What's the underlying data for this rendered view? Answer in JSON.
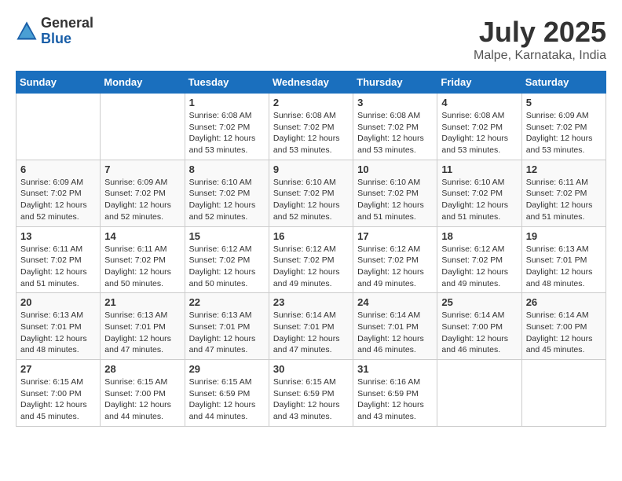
{
  "header": {
    "logo_general": "General",
    "logo_blue": "Blue",
    "month": "July 2025",
    "location": "Malpe, Karnataka, India"
  },
  "weekdays": [
    "Sunday",
    "Monday",
    "Tuesday",
    "Wednesday",
    "Thursday",
    "Friday",
    "Saturday"
  ],
  "weeks": [
    [
      {
        "day": "",
        "detail": ""
      },
      {
        "day": "",
        "detail": ""
      },
      {
        "day": "1",
        "detail": "Sunrise: 6:08 AM\nSunset: 7:02 PM\nDaylight: 12 hours and 53 minutes."
      },
      {
        "day": "2",
        "detail": "Sunrise: 6:08 AM\nSunset: 7:02 PM\nDaylight: 12 hours and 53 minutes."
      },
      {
        "day": "3",
        "detail": "Sunrise: 6:08 AM\nSunset: 7:02 PM\nDaylight: 12 hours and 53 minutes."
      },
      {
        "day": "4",
        "detail": "Sunrise: 6:08 AM\nSunset: 7:02 PM\nDaylight: 12 hours and 53 minutes."
      },
      {
        "day": "5",
        "detail": "Sunrise: 6:09 AM\nSunset: 7:02 PM\nDaylight: 12 hours and 53 minutes."
      }
    ],
    [
      {
        "day": "6",
        "detail": "Sunrise: 6:09 AM\nSunset: 7:02 PM\nDaylight: 12 hours and 52 minutes."
      },
      {
        "day": "7",
        "detail": "Sunrise: 6:09 AM\nSunset: 7:02 PM\nDaylight: 12 hours and 52 minutes."
      },
      {
        "day": "8",
        "detail": "Sunrise: 6:10 AM\nSunset: 7:02 PM\nDaylight: 12 hours and 52 minutes."
      },
      {
        "day": "9",
        "detail": "Sunrise: 6:10 AM\nSunset: 7:02 PM\nDaylight: 12 hours and 52 minutes."
      },
      {
        "day": "10",
        "detail": "Sunrise: 6:10 AM\nSunset: 7:02 PM\nDaylight: 12 hours and 51 minutes."
      },
      {
        "day": "11",
        "detail": "Sunrise: 6:10 AM\nSunset: 7:02 PM\nDaylight: 12 hours and 51 minutes."
      },
      {
        "day": "12",
        "detail": "Sunrise: 6:11 AM\nSunset: 7:02 PM\nDaylight: 12 hours and 51 minutes."
      }
    ],
    [
      {
        "day": "13",
        "detail": "Sunrise: 6:11 AM\nSunset: 7:02 PM\nDaylight: 12 hours and 51 minutes."
      },
      {
        "day": "14",
        "detail": "Sunrise: 6:11 AM\nSunset: 7:02 PM\nDaylight: 12 hours and 50 minutes."
      },
      {
        "day": "15",
        "detail": "Sunrise: 6:12 AM\nSunset: 7:02 PM\nDaylight: 12 hours and 50 minutes."
      },
      {
        "day": "16",
        "detail": "Sunrise: 6:12 AM\nSunset: 7:02 PM\nDaylight: 12 hours and 49 minutes."
      },
      {
        "day": "17",
        "detail": "Sunrise: 6:12 AM\nSunset: 7:02 PM\nDaylight: 12 hours and 49 minutes."
      },
      {
        "day": "18",
        "detail": "Sunrise: 6:12 AM\nSunset: 7:02 PM\nDaylight: 12 hours and 49 minutes."
      },
      {
        "day": "19",
        "detail": "Sunrise: 6:13 AM\nSunset: 7:01 PM\nDaylight: 12 hours and 48 minutes."
      }
    ],
    [
      {
        "day": "20",
        "detail": "Sunrise: 6:13 AM\nSunset: 7:01 PM\nDaylight: 12 hours and 48 minutes."
      },
      {
        "day": "21",
        "detail": "Sunrise: 6:13 AM\nSunset: 7:01 PM\nDaylight: 12 hours and 47 minutes."
      },
      {
        "day": "22",
        "detail": "Sunrise: 6:13 AM\nSunset: 7:01 PM\nDaylight: 12 hours and 47 minutes."
      },
      {
        "day": "23",
        "detail": "Sunrise: 6:14 AM\nSunset: 7:01 PM\nDaylight: 12 hours and 47 minutes."
      },
      {
        "day": "24",
        "detail": "Sunrise: 6:14 AM\nSunset: 7:01 PM\nDaylight: 12 hours and 46 minutes."
      },
      {
        "day": "25",
        "detail": "Sunrise: 6:14 AM\nSunset: 7:00 PM\nDaylight: 12 hours and 46 minutes."
      },
      {
        "day": "26",
        "detail": "Sunrise: 6:14 AM\nSunset: 7:00 PM\nDaylight: 12 hours and 45 minutes."
      }
    ],
    [
      {
        "day": "27",
        "detail": "Sunrise: 6:15 AM\nSunset: 7:00 PM\nDaylight: 12 hours and 45 minutes."
      },
      {
        "day": "28",
        "detail": "Sunrise: 6:15 AM\nSunset: 7:00 PM\nDaylight: 12 hours and 44 minutes."
      },
      {
        "day": "29",
        "detail": "Sunrise: 6:15 AM\nSunset: 6:59 PM\nDaylight: 12 hours and 44 minutes."
      },
      {
        "day": "30",
        "detail": "Sunrise: 6:15 AM\nSunset: 6:59 PM\nDaylight: 12 hours and 43 minutes."
      },
      {
        "day": "31",
        "detail": "Sunrise: 6:16 AM\nSunset: 6:59 PM\nDaylight: 12 hours and 43 minutes."
      },
      {
        "day": "",
        "detail": ""
      },
      {
        "day": "",
        "detail": ""
      }
    ]
  ]
}
